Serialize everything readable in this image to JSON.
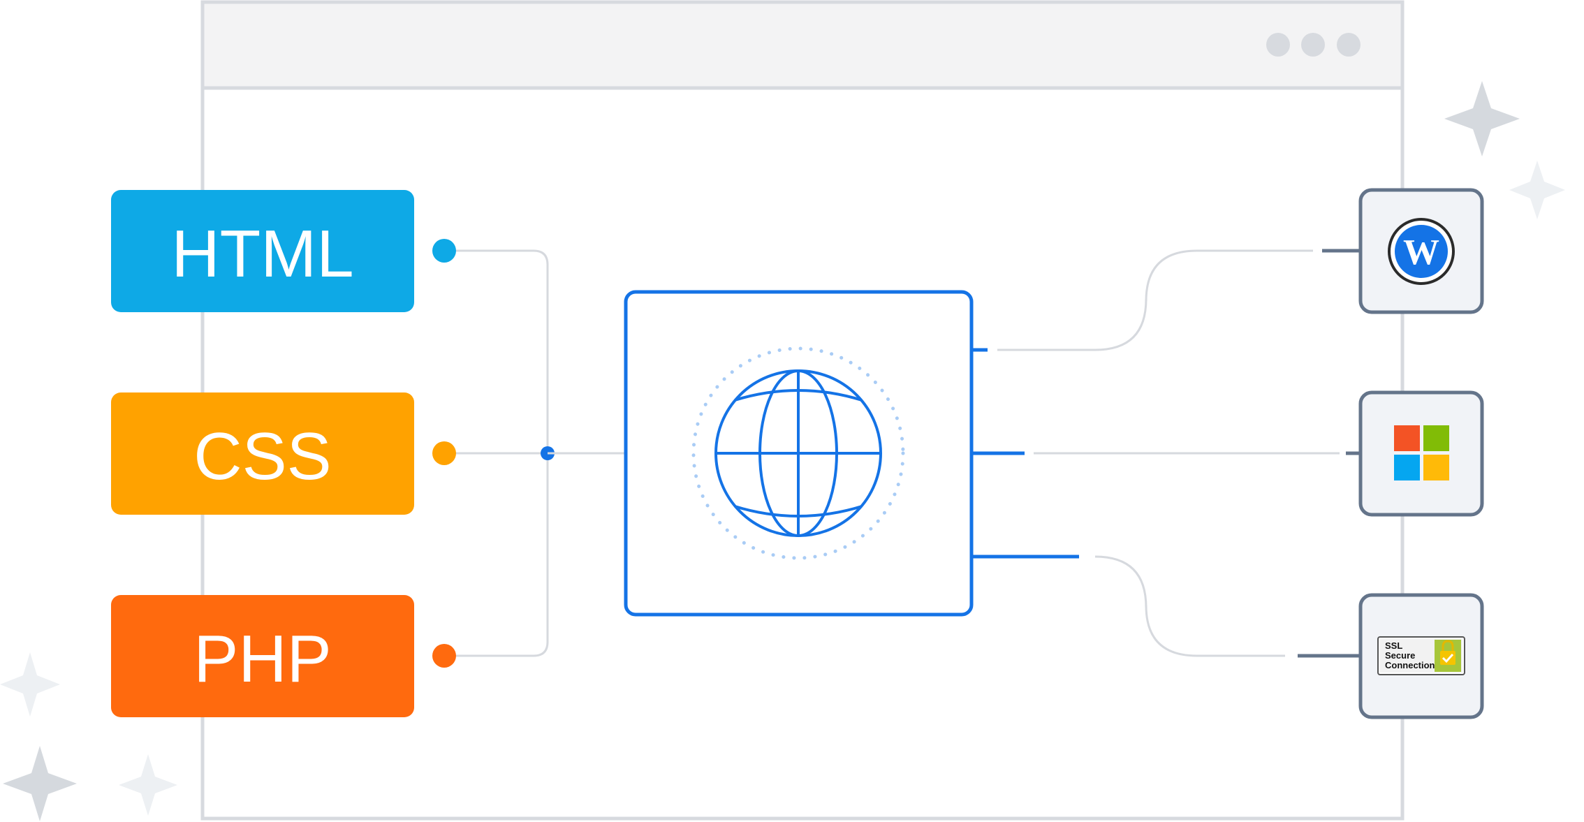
{
  "languages": [
    {
      "label": "HTML",
      "color": "#0EA9E6"
    },
    {
      "label": "CSS",
      "color": "#FFA200"
    },
    {
      "label": "PHP",
      "color": "#FF6A0E"
    }
  ],
  "services": [
    {
      "name": "wordpress-icon"
    },
    {
      "name": "windows-icon"
    },
    {
      "name": "ssl-secure-icon",
      "badge": [
        "SSL",
        "Secure",
        "Connection"
      ]
    }
  ],
  "colors": {
    "accent": "#1473E6",
    "frame": "#D7DADF",
    "titlebar": "#F3F3F4",
    "connector": "#D6D9DE",
    "service_border": "#64748A",
    "service_fill": "#F1F3F7",
    "sparkle_dark": "#D5D9DE",
    "sparkle_light": "#EDF0F3"
  }
}
